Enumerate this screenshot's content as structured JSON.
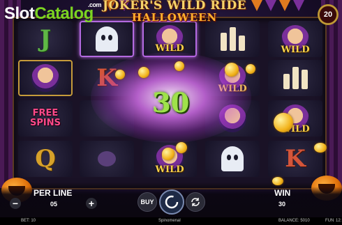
{
  "watermark": {
    "part1": "Slot",
    "part2": "Catalog",
    "suffix": ".com"
  },
  "game": {
    "title_line1": "JOKER'S WILD RIDE",
    "title_line2": "HALLOWEEN"
  },
  "counter": {
    "value": "20"
  },
  "reels": {
    "symbols": {
      "wild": "WILD",
      "free_spins_line1": "FREE",
      "free_spins_line2": "SPINS",
      "j": "J",
      "k": "K",
      "q": "Q"
    }
  },
  "win_popup": {
    "amount": "30"
  },
  "controls": {
    "per_line_label": "PER LINE",
    "per_line_value": "05",
    "minus": "−",
    "plus": "+",
    "buy": "BUY",
    "win_label": "WIN",
    "win_value": "30"
  },
  "footer": {
    "bet": "BET: 10",
    "provider": "Spinomenal",
    "balance": "BALANCE: 5010",
    "mode": "FUN",
    "clock": "12:"
  },
  "colors": {
    "accent_green": "#9fe24a",
    "gold": "#f5d36a",
    "purple": "#b46ae0"
  },
  "icons": [
    "spin-icon",
    "autoplay-icon",
    "coin-icon",
    "ghost-icon",
    "candle-icon",
    "spider-icon",
    "jester-icon",
    "pumpkin-icon"
  ]
}
